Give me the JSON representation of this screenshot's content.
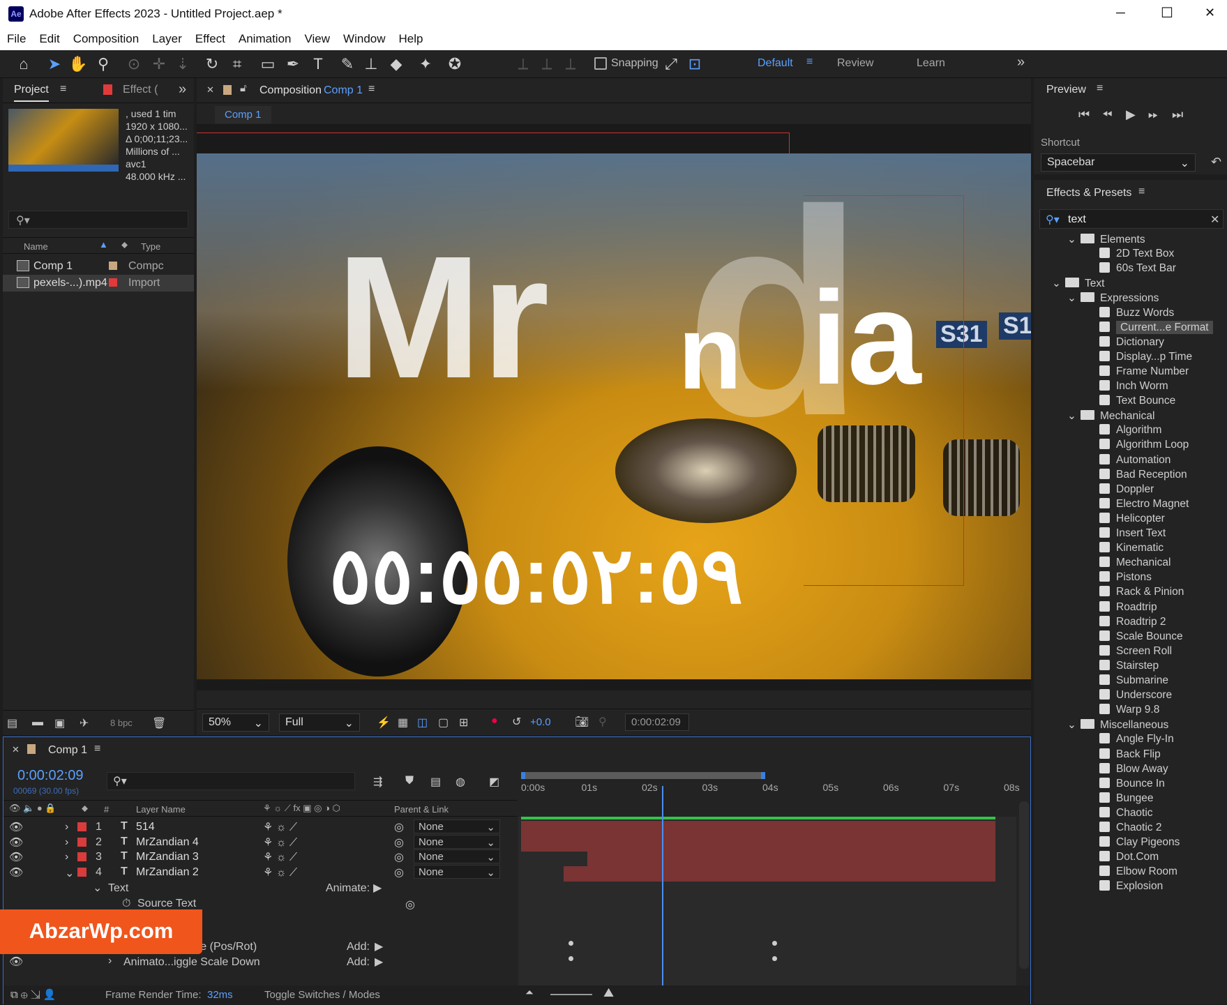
{
  "window": {
    "title": "Adobe After Effects 2023 - Untitled Project.aep *",
    "app_badge": "Ae",
    "minimize": "─",
    "maximize": "☐",
    "close": "✕"
  },
  "menu": [
    "File",
    "Edit",
    "Composition",
    "Layer",
    "Effect",
    "Animation",
    "View",
    "Window",
    "Help"
  ],
  "toolbar": {
    "snapping": "Snapping",
    "workspaces": [
      "Default",
      "Review",
      "Learn"
    ],
    "active_workspace": "Default"
  },
  "project": {
    "tab": "Project",
    "tab2": "Effect (",
    "footage_info": [
      ", used 1 tim",
      "1920 x 1080...",
      "Δ 0;00;11;23...",
      "Millions of ...",
      "avc1",
      "48.000 kHz ..."
    ],
    "columns": {
      "name": "Name",
      "type": "Type"
    },
    "items": [
      {
        "name": "Comp 1",
        "type": "Compc",
        "color": "#c8a880"
      },
      {
        "name": "pexels-...).mp4",
        "type": "Import",
        "color": "#e23a3a"
      }
    ],
    "bpc": "8 bpc"
  },
  "composition": {
    "tab_prefix": "Composition",
    "tab_name": "Comp 1",
    "sub_tab": "Comp 1",
    "overlay_text": {
      "big1": "Mr",
      "big2": "n",
      "big3": "ia",
      "clock": "٥٥:٥٥:٥٢:٥٩",
      "plate1": "S31",
      "plate2": "S1"
    },
    "zoom": "50%",
    "quality": "Full",
    "exposure": "+0.0",
    "timecode": "0:00:02:09"
  },
  "preview": {
    "title": "Preview",
    "shortcut_label": "Shortcut",
    "shortcut_value": "Spacebar"
  },
  "effects_presets": {
    "title": "Effects & Presets",
    "search_value": "text",
    "tree": [
      {
        "t": "folder",
        "label": "Elements",
        "depth": 2
      },
      {
        "t": "item",
        "label": "2D Text Box"
      },
      {
        "t": "item",
        "label": "60s Text Bar"
      },
      {
        "t": "folder",
        "label": "Text",
        "depth": 1
      },
      {
        "t": "folder",
        "label": "Expressions",
        "depth": 2
      },
      {
        "t": "item",
        "label": "Buzz Words"
      },
      {
        "t": "item",
        "label": "Current...e Format",
        "selected": true
      },
      {
        "t": "item",
        "label": "Dictionary"
      },
      {
        "t": "item",
        "label": "Display...p Time"
      },
      {
        "t": "item",
        "label": "Frame Number"
      },
      {
        "t": "item",
        "label": "Inch Worm"
      },
      {
        "t": "item",
        "label": "Text Bounce"
      },
      {
        "t": "folder",
        "label": "Mechanical",
        "depth": 2
      },
      {
        "t": "item",
        "label": "Algorithm"
      },
      {
        "t": "item",
        "label": "Algorithm Loop"
      },
      {
        "t": "item",
        "label": "Automation"
      },
      {
        "t": "item",
        "label": "Bad Reception"
      },
      {
        "t": "item",
        "label": "Doppler"
      },
      {
        "t": "item",
        "label": "Electro Magnet"
      },
      {
        "t": "item",
        "label": "Helicopter"
      },
      {
        "t": "item",
        "label": "Insert Text"
      },
      {
        "t": "item",
        "label": "Kinematic"
      },
      {
        "t": "item",
        "label": "Mechanical"
      },
      {
        "t": "item",
        "label": "Pistons"
      },
      {
        "t": "item",
        "label": "Rack & Pinion"
      },
      {
        "t": "item",
        "label": "Roadtrip"
      },
      {
        "t": "item",
        "label": "Roadtrip 2"
      },
      {
        "t": "item",
        "label": "Scale Bounce"
      },
      {
        "t": "item",
        "label": "Screen Roll"
      },
      {
        "t": "item",
        "label": "Stairstep"
      },
      {
        "t": "item",
        "label": "Submarine"
      },
      {
        "t": "item",
        "label": "Underscore"
      },
      {
        "t": "item",
        "label": "Warp 9.8"
      },
      {
        "t": "folder",
        "label": "Miscellaneous",
        "depth": 2
      },
      {
        "t": "item",
        "label": "Angle Fly-In"
      },
      {
        "t": "item",
        "label": "Back Flip"
      },
      {
        "t": "item",
        "label": "Blow Away"
      },
      {
        "t": "item",
        "label": "Bounce In"
      },
      {
        "t": "item",
        "label": "Bungee"
      },
      {
        "t": "item",
        "label": "Chaotic"
      },
      {
        "t": "item",
        "label": "Chaotic 2"
      },
      {
        "t": "item",
        "label": "Clay Pigeons"
      },
      {
        "t": "item",
        "label": "Dot.Com"
      },
      {
        "t": "item",
        "label": "Elbow Room"
      },
      {
        "t": "item",
        "label": "Explosion"
      }
    ]
  },
  "timeline": {
    "tab": "Comp 1",
    "timecode": "0:00:02:09",
    "fps": "00069 (30.00 fps)",
    "cols": {
      "num": "#",
      "layer": "Layer Name",
      "parent": "Parent & Link"
    },
    "ruler": [
      "0:00s",
      "01s",
      "02s",
      "03s",
      "04s",
      "05s",
      "06s",
      "07s",
      "08s"
    ],
    "layers": [
      {
        "num": "1",
        "name": "514",
        "parent": "None",
        "bar_start": 0.0
      },
      {
        "num": "2",
        "name": "MrZandian 4",
        "parent": "None",
        "bar_start": 0.0
      },
      {
        "num": "3",
        "name": "MrZandian 3",
        "parent": "None",
        "bar_start": 0.14
      },
      {
        "num": "4",
        "name": "MrZandian 2",
        "parent": "None",
        "bar_start": 0.09
      }
    ],
    "text_group": "Text",
    "animate": "Animate:",
    "source_text": "Source Text",
    "animators": [
      {
        "name": "Animato...xplode (Pos/Rot)",
        "add": "Add:"
      },
      {
        "name": "Animato...iggle Scale Down",
        "add": "Add:"
      }
    ],
    "footer": {
      "render_label": "Frame Render Time:",
      "render_value": "32ms",
      "toggle": "Toggle Switches / Modes"
    },
    "playhead_fraction": 0.297
  },
  "watermark": "AbzarWp.com"
}
